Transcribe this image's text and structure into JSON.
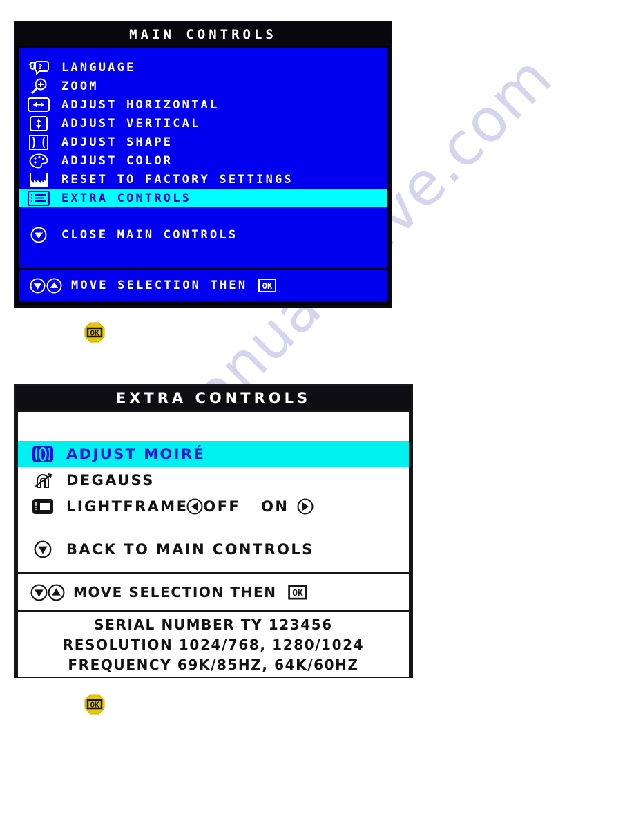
{
  "watermark": {
    "line1": "manualshive.com",
    "line2": "manualshive.com"
  },
  "main_controls": {
    "title": "MAIN CONTROLS",
    "items": [
      {
        "icon": "language-icon",
        "label": "LANGUAGE",
        "selected": false
      },
      {
        "icon": "zoom-icon",
        "label": "ZOOM",
        "selected": false
      },
      {
        "icon": "horizontal-icon",
        "label": "ADJUST HORIZONTAL",
        "selected": false
      },
      {
        "icon": "vertical-icon",
        "label": "ADJUST VERTICAL",
        "selected": false
      },
      {
        "icon": "shape-icon",
        "label": "ADJUST SHAPE",
        "selected": false
      },
      {
        "icon": "color-icon",
        "label": "ADJUST COLOR",
        "selected": false
      },
      {
        "icon": "reset-icon",
        "label": "RESET TO FACTORY SETTINGS",
        "selected": false
      },
      {
        "icon": "list-icon",
        "label": "EXTRA CONTROLS",
        "selected": true
      }
    ],
    "close_label": "CLOSE MAIN CONTROLS",
    "footer_label": "MOVE SELECTION THEN",
    "footer_key": "OK",
    "colors": {
      "background": "#0000EE",
      "highlight": "#00FFFF",
      "title_bar": "#07070D",
      "text": "#FFFFFF"
    }
  },
  "extra_controls": {
    "title": "EXTRA CONTROLS",
    "items": [
      {
        "icon": "moire-icon",
        "label": "ADJUST MOIRÉ",
        "selected": true
      },
      {
        "icon": "degauss-icon",
        "label": "DEGAUSS",
        "selected": false
      },
      {
        "icon": "lightframe-icon",
        "label": "LIGHTFRAME",
        "selected": false,
        "option_off": "OFF",
        "option_on": "ON"
      }
    ],
    "back_label": "BACK TO MAIN CONTROLS",
    "hint_label": "MOVE SELECTION THEN",
    "hint_key": "OK",
    "info": [
      "SERIAL NUMBER TY 123456",
      "RESOLUTION 1024/768, 1280/1024",
      "FREQUENCY 69K/85HZ, 64K/60HZ"
    ],
    "colors": {
      "background": "#FFFFFF",
      "highlight": "#00F0F0",
      "title_bar": "#0D0D12",
      "text": "#121212",
      "selected_text": "#1414DD"
    }
  },
  "badges": {
    "ok_badge_1": {
      "name": "ok-button-badge",
      "label": "OK",
      "color": "#E8C600"
    },
    "ok_badge_2": {
      "name": "ok-button-badge",
      "label": "OK",
      "color": "#E8C600"
    }
  }
}
